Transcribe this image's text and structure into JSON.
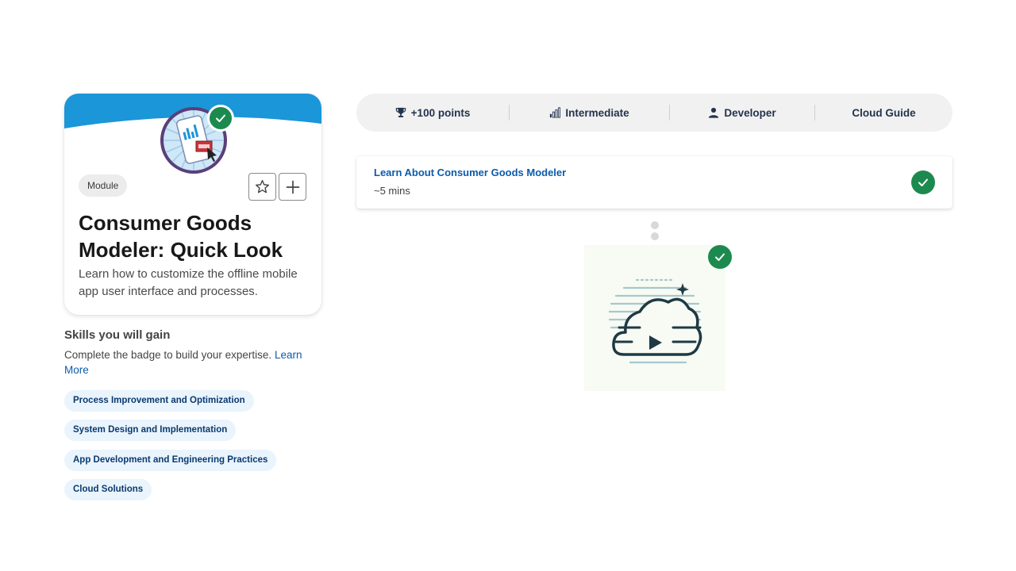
{
  "module_card": {
    "type_label": "Module",
    "title": "Consumer Goods Modeler: Quick Look",
    "description": "Learn how to customize the offline mobile app user interface and processes.",
    "banner_color": "#1b96d8"
  },
  "skills": {
    "title": "Skills you will gain",
    "description": "Complete the badge to build your expertise.",
    "learn_more": "Learn More",
    "items": [
      "Process Improvement and Optimization",
      "System Design and Implementation",
      "App Development and Engineering Practices",
      "Cloud Solutions"
    ]
  },
  "stats": {
    "points": "+100 points",
    "level": "Intermediate",
    "role": "Developer",
    "product": "Cloud Guide"
  },
  "unit": {
    "title": "Learn About Consumer Goods Modeler",
    "duration": "~5 mins"
  },
  "colors": {
    "success": "#1c8a4e",
    "link": "#0b5cab",
    "pill_bg": "#eaf4fd"
  }
}
